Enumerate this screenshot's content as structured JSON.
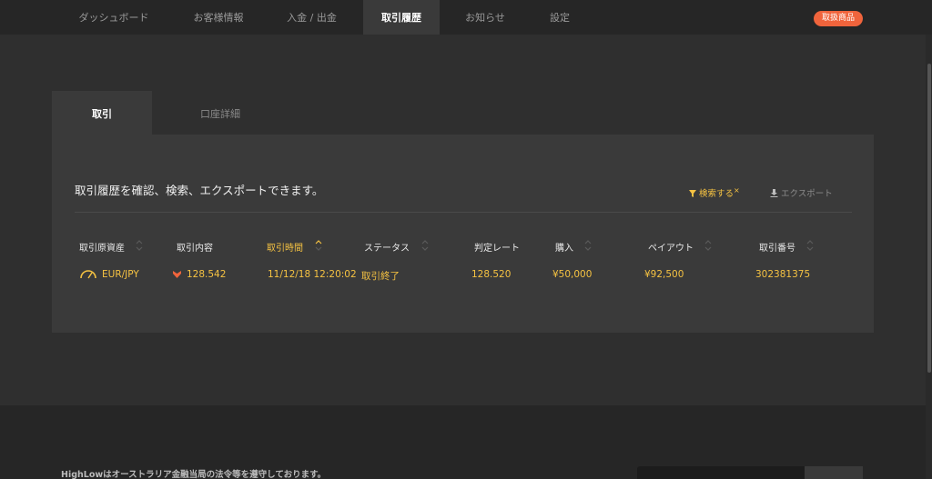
{
  "nav": {
    "items": [
      {
        "label": "ダッシュボード"
      },
      {
        "label": "お客様情報"
      },
      {
        "label": "入金 / 出金"
      },
      {
        "label": "取引履歴"
      },
      {
        "label": "お知らせ"
      },
      {
        "label": "設定"
      }
    ],
    "active": "取引履歴",
    "badge": "取扱商品"
  },
  "tabs": [
    {
      "label": "取引"
    },
    {
      "label": "口座詳細"
    }
  ],
  "panel": {
    "description": "取引履歴を確認、検索、エクスポートできます。",
    "filter_label": "検索する",
    "filter_clear": "×",
    "export_label": "エクスポート"
  },
  "table": {
    "headers": [
      "取引原資産",
      "取引内容",
      "取引時間",
      "ステータス",
      "判定レート",
      "購入",
      "ペイアウト",
      "取引番号"
    ],
    "sorted_column": "取引時間",
    "rows": [
      {
        "asset": "EUR/JPY",
        "direction": "down",
        "rate": "128.542",
        "time": "11/12/18 12:20:02",
        "status": "取引終了",
        "closing_rate": "128.520",
        "investment": "¥50,000",
        "payout": "¥92,500",
        "trade_id": "302381375"
      }
    ]
  },
  "footer": {
    "text": "HighLowはオーストラリア金融当局の法令等を遵守しております。"
  },
  "colors": {
    "accent": "#f5c242",
    "badge": "#f0643c",
    "down": "#f0643c"
  }
}
